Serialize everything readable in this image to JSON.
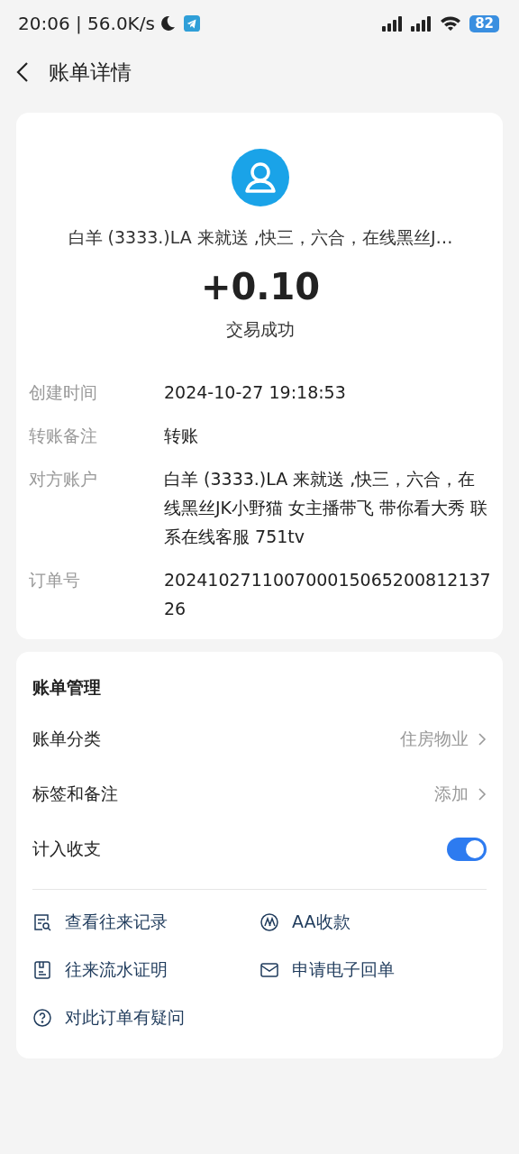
{
  "status_bar": {
    "time": "20:06 | 56.0K/s",
    "battery": "82"
  },
  "header": {
    "title": "账单详情"
  },
  "summary": {
    "name": "白羊 (3333.)LA 来就送 ,快三，六合，在线黑丝J…",
    "amount": "+0.10",
    "status": "交易成功"
  },
  "details": [
    {
      "label": "创建时间",
      "value": "2024-10-27 19:18:53"
    },
    {
      "label": "转账备注",
      "value": "转账"
    },
    {
      "label": "对方账户",
      "value": "白羊 (3333.)LA 来就送 ,快三，六合，在线黑丝JK小野猫 女主播带飞 带你看大秀 联系在线客服 751tv"
    },
    {
      "label": "订单号",
      "value": "20241027110070001506520081213726"
    }
  ],
  "management": {
    "title": "账单管理",
    "rows": [
      {
        "kind": "value",
        "label": "账单分类",
        "value": "住房物业"
      },
      {
        "kind": "value",
        "label": "标签和备注",
        "value": "添加"
      },
      {
        "kind": "toggle",
        "label": "计入收支",
        "on": true
      }
    ]
  },
  "actions": [
    {
      "kind": "records",
      "label": "查看往来记录"
    },
    {
      "kind": "aa",
      "label": "AA收款"
    },
    {
      "kind": "statement",
      "label": "往来流水证明"
    },
    {
      "kind": "receipt",
      "label": "申请电子回单"
    },
    {
      "kind": "question",
      "label": "对此订单有疑问"
    }
  ]
}
